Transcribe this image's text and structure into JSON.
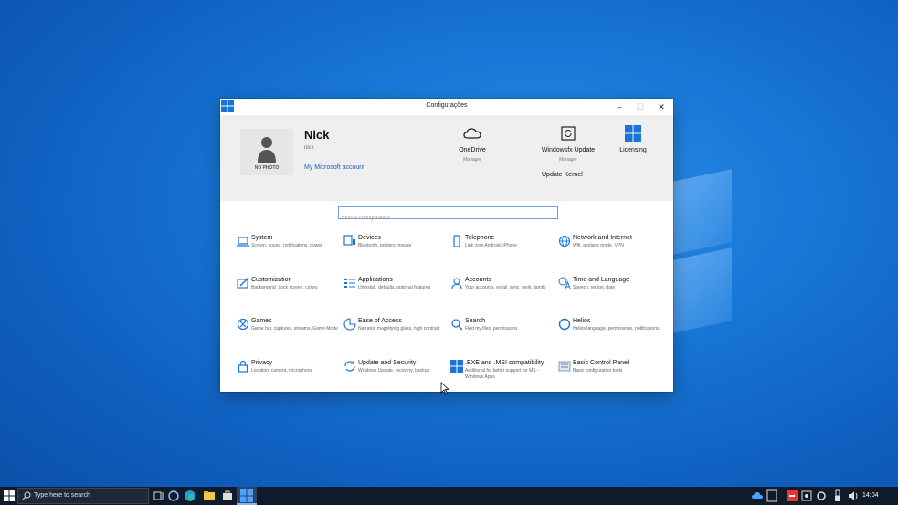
{
  "window": {
    "title": "Configurações",
    "controls": {
      "minimize": "–",
      "maximize": "☐",
      "close": "✕"
    }
  },
  "profile": {
    "name": "Nick",
    "username": "nick",
    "photo_text": "NO PHOTO",
    "account_link": "My Microsoft account"
  },
  "quick_actions": [
    {
      "label": "OneDrive",
      "sub": "Manager",
      "icon": "cloud-icon"
    },
    {
      "label": "Windowsfx Update",
      "sub": "Manager",
      "icon": "update-icon"
    },
    {
      "label": "Licensing",
      "sub": "",
      "icon": "windows-logo-icon"
    }
  ],
  "update_kernel": "Update Kernel",
  "search": {
    "placeholder": "Find a configuration",
    "value": ""
  },
  "tiles": [
    {
      "name": "System",
      "desc": "Screen, sound, notifications, power",
      "icon": "laptop-icon"
    },
    {
      "name": "Devices",
      "desc": "Bluetooth, printers, mouse",
      "icon": "keyboard-icon"
    },
    {
      "name": "Telephone",
      "desc": "Link your Android, iPhone",
      "icon": "phone-icon"
    },
    {
      "name": "Network and Internet",
      "desc": "Wifi, airplane mode, VPN",
      "icon": "globe-icon"
    },
    {
      "name": "Customization",
      "desc": "Background, Lock screen, colors",
      "icon": "brush-icon"
    },
    {
      "name": "Applications",
      "desc": "Uninstall, defaults, optional features",
      "icon": "apps-list-icon"
    },
    {
      "name": "Accounts",
      "desc": "Your accounts, email, sync, work, family",
      "icon": "person-icon"
    },
    {
      "name": "Time and Language",
      "desc": "Speech, region, date",
      "icon": "language-icon"
    },
    {
      "name": "Games",
      "desc": "Game bar, captures, streams, Game Mode",
      "icon": "xbox-icon"
    },
    {
      "name": "Ease of Access",
      "desc": "Narrator, magnifying glass, high contrast",
      "icon": "ease-access-icon"
    },
    {
      "name": "Search",
      "desc": "Find my files, permissions",
      "icon": "search-icon"
    },
    {
      "name": "Helios",
      "desc": "Helios language, permissions, notifications",
      "icon": "circle-icon"
    },
    {
      "name": "Privacy",
      "desc": "Location, camera, microphone",
      "icon": "lock-icon"
    },
    {
      "name": "Update and Security",
      "desc": "Windows Update, recovery, backup",
      "icon": "sync-icon"
    },
    {
      "name": ".EXE and .MSI compatibility",
      "desc": "Additional for better support for MS - Windows Apps",
      "icon": "windows-logo-icon"
    },
    {
      "name": "Basic Control Panel",
      "desc": "Basic configuration tools",
      "icon": "control-panel-icon"
    }
  ],
  "taskbar": {
    "search_placeholder": "Type here to search",
    "clock": "14:04"
  },
  "colors": {
    "accent": "#1a73d9",
    "link": "#1a5fb4",
    "taskbar": "#0f1a2a"
  }
}
